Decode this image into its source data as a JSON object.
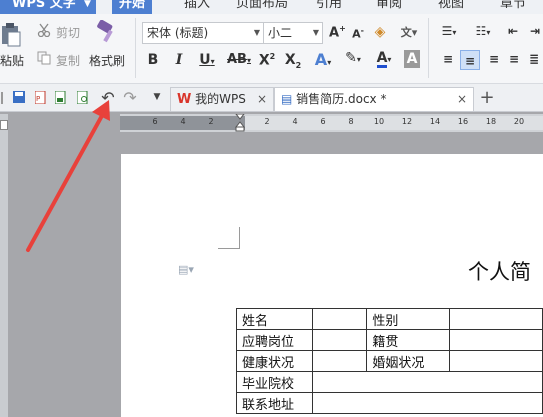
{
  "app": {
    "name": "WPS 文字"
  },
  "menu": {
    "tabs": [
      "开始",
      "插入",
      "页面布局",
      "引用",
      "审阅",
      "视图",
      "章节"
    ],
    "active": "开始"
  },
  "ribbon": {
    "paste": "粘贴",
    "cut": "剪切",
    "copy": "复制",
    "format_painter": "格式刷",
    "font_name": "宋体 (标题)",
    "font_size": "小二"
  },
  "tabs": [
    {
      "label": "我的WPS",
      "close": "×"
    },
    {
      "label": "销售简历.docx *",
      "close": "×"
    }
  ],
  "ruler": {
    "ticks": [
      "6",
      "4",
      "2",
      "",
      "2",
      "4",
      "6",
      "8",
      "10",
      "12",
      "14",
      "16",
      "18",
      "20"
    ]
  },
  "document": {
    "title": "个人简",
    "table": [
      [
        "姓名",
        "",
        "性别",
        ""
      ],
      [
        "应聘岗位",
        "",
        "籍贯",
        ""
      ],
      [
        "健康状况",
        "",
        "婚姻状况",
        ""
      ],
      [
        "毕业院校",
        "",
        "",
        ""
      ],
      [
        "联系地址",
        "",
        "",
        ""
      ]
    ]
  },
  "colors": {
    "accent": "#4d7fd1",
    "arrow": "#e8413b",
    "wps_logo": "#d9352b"
  },
  "annotation": {
    "type": "arrow",
    "points_to": "undo-button"
  }
}
